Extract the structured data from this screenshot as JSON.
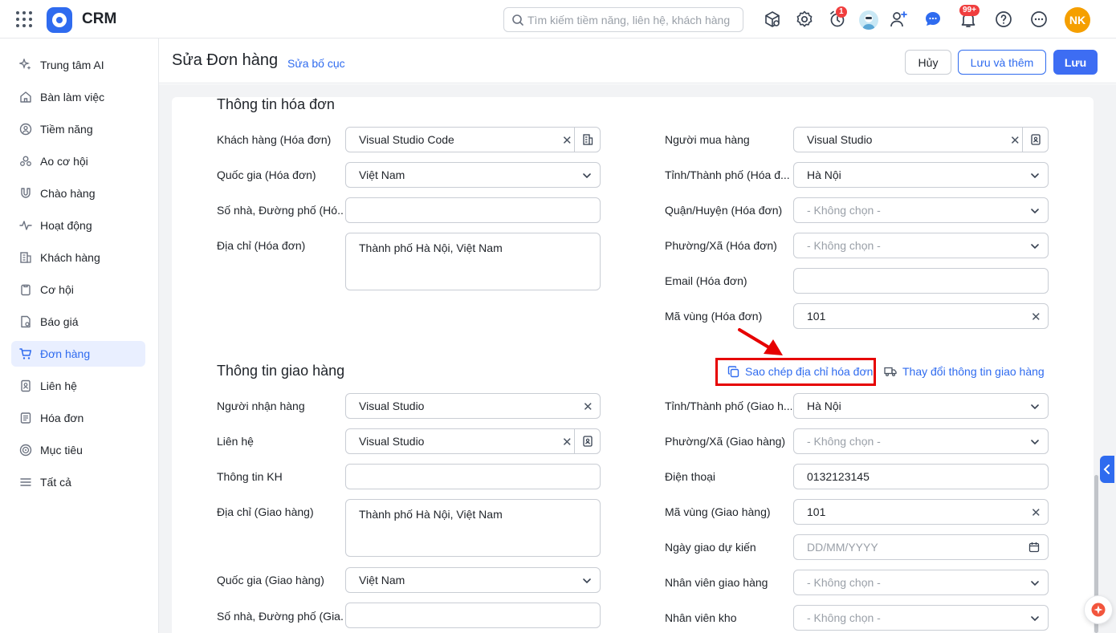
{
  "app": {
    "name": "CRM"
  },
  "search": {
    "placeholder": "Tìm kiếm tiềm năng, liên hệ, khách hàng"
  },
  "topbar": {
    "reminder_badge": "1",
    "notification_badge": "99+",
    "user_initials": "NK"
  },
  "sidebar": {
    "items": [
      {
        "label": "Trung tâm AI",
        "icon": "sparkle-icon"
      },
      {
        "label": "Bàn làm việc",
        "icon": "home-icon"
      },
      {
        "label": "Tiềm năng",
        "icon": "target-user-icon"
      },
      {
        "label": "Ao cơ hội",
        "icon": "users-icon"
      },
      {
        "label": "Chào hàng",
        "icon": "magnet-icon"
      },
      {
        "label": "Hoạt động",
        "icon": "activity-icon"
      },
      {
        "label": "Khách hàng",
        "icon": "building-icon"
      },
      {
        "label": "Cơ hội",
        "icon": "clipboard-icon"
      },
      {
        "label": "Báo giá",
        "icon": "quote-doc-icon"
      },
      {
        "label": "Đơn hàng",
        "icon": "cart-icon",
        "active": true
      },
      {
        "label": "Liên hệ",
        "icon": "contact-book-icon"
      },
      {
        "label": "Hóa đơn",
        "icon": "invoice-icon"
      },
      {
        "label": "Mục tiêu",
        "icon": "goal-icon"
      },
      {
        "label": "Tất cả",
        "icon": "menu-icon"
      }
    ]
  },
  "header": {
    "title": "Sửa Đơn hàng",
    "edit_layout": "Sửa bố cục",
    "cancel": "Hủy",
    "save_and_add": "Lưu và thêm",
    "save": "Lưu"
  },
  "invoice_section": {
    "title": "Thông tin hóa đơn",
    "customer": {
      "label": "Khách hàng (Hóa đơn)",
      "value": "Visual Studio Code"
    },
    "country": {
      "label": "Quốc gia (Hóa đơn)",
      "value": "Việt Nam"
    },
    "street": {
      "label": "Số nhà, Đường phố (Hó...",
      "value": ""
    },
    "address": {
      "label": "Địa chỉ (Hóa đơn)",
      "value": "Thành phố Hà Nội, Việt Nam"
    },
    "buyer": {
      "label": "Người mua hàng",
      "value": "Visual Studio"
    },
    "province": {
      "label": "Tỉnh/Thành phố (Hóa đ...",
      "value": "Hà Nội"
    },
    "district": {
      "label": "Quận/Huyện (Hóa đơn)",
      "placeholder": "- Không chọn -"
    },
    "ward": {
      "label": "Phường/Xã (Hóa đơn)",
      "placeholder": "- Không chọn -"
    },
    "email": {
      "label": "Email (Hóa đơn)",
      "value": ""
    },
    "area_code": {
      "label": "Mã vùng (Hóa đơn)",
      "value": "101"
    }
  },
  "shipping_section": {
    "title": "Thông tin giao hàng",
    "copy_address": "Sao chép địa chỉ hóa đơn",
    "change_shipping": "Thay đổi thông tin giao hàng",
    "recipient": {
      "label": "Người nhận hàng",
      "value": "Visual Studio"
    },
    "contact": {
      "label": "Liên hệ",
      "value": "Visual Studio"
    },
    "customer_info": {
      "label": "Thông tin KH",
      "value": ""
    },
    "address": {
      "label": "Địa chỉ (Giao hàng)",
      "value": "Thành phố Hà Nội, Việt Nam"
    },
    "country": {
      "label": "Quốc gia (Giao hàng)",
      "value": "Việt Nam"
    },
    "street": {
      "label": "Số nhà, Đường phố (Gia...",
      "value": ""
    },
    "province": {
      "label": "Tỉnh/Thành phố (Giao h...",
      "value": "Hà Nội"
    },
    "ward": {
      "label": "Phường/Xã (Giao hàng)",
      "placeholder": "- Không chọn -"
    },
    "phone": {
      "label": "Điện thoại",
      "value": "0132123145"
    },
    "area_code": {
      "label": "Mã vùng (Giao hàng)",
      "value": "101"
    },
    "delivery_date": {
      "label": "Ngày giao dự kiến",
      "placeholder": "DD/MM/YYYY"
    },
    "delivery_staff": {
      "label": "Nhân viên giao hàng",
      "placeholder": "- Không chọn -"
    },
    "warehouse_staff": {
      "label": "Nhân viên kho",
      "placeholder": "- Không chọn -"
    }
  },
  "colors": {
    "accent": "#2f6bef",
    "highlight": "#e60000",
    "active_bg": "#e9efff"
  }
}
